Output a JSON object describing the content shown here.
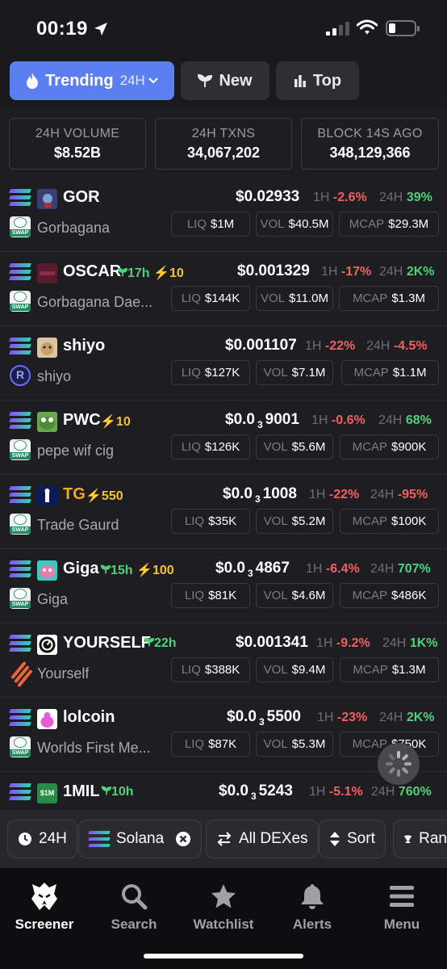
{
  "status": {
    "time": "00:19"
  },
  "tabs": [
    {
      "label": "Trending",
      "sub": "24H",
      "active": true
    },
    {
      "label": "New",
      "active": false
    },
    {
      "label": "Top",
      "active": false
    }
  ],
  "stats": [
    {
      "label": "24H VOLUME",
      "value": "$8.52B"
    },
    {
      "label": "24H TXNS",
      "value": "34,067,202"
    },
    {
      "label": "BLOCK 14S AGO",
      "value": "348,129,366"
    }
  ],
  "labels": {
    "h1": "1H",
    "h24": "24H",
    "liq": "LIQ",
    "vol": "VOL",
    "mcap": "MCAP"
  },
  "tokens": [
    {
      "symbol": "GOR",
      "name": "Gorbagana",
      "price": "$0.02933",
      "h1": "-2.6%",
      "h24": "39%",
      "liq": "$1M",
      "vol": "$40.5M",
      "mcap": "$29.3M"
    },
    {
      "symbol": "OSCAR",
      "age": "17h",
      "boost": "10",
      "name": "Gorbagana Dae...",
      "price": "$0.001329",
      "h1": "-17%",
      "h24": "2K%",
      "liq": "$144K",
      "vol": "$11.0M",
      "mcap": "$1.3M"
    },
    {
      "symbol": "shiyo",
      "name": "shiyo",
      "price": "$0.001107",
      "h1": "-22%",
      "h24": "-4.5%",
      "liq": "$127K",
      "vol": "$7.1M",
      "mcap": "$1.1M"
    },
    {
      "symbol": "PWC",
      "boost": "10",
      "name": "pepe wif cig",
      "price_pre": "$0.0",
      "price_sub": "3",
      "price_post": "9001",
      "h1": "-0.6%",
      "h24": "68%",
      "liq": "$126K",
      "vol": "$5.6M",
      "mcap": "$900K"
    },
    {
      "symbol": "TG",
      "boost": "550",
      "name": "Trade Gaurd",
      "price_pre": "$0.0",
      "price_sub": "3",
      "price_post": "1008",
      "h1": "-22%",
      "h24": "-95%",
      "liq": "$35K",
      "vol": "$5.2M",
      "mcap": "$100K"
    },
    {
      "symbol": "Giga",
      "age": "15h",
      "boost": "100",
      "name": "Giga",
      "price_pre": "$0.0",
      "price_sub": "3",
      "price_post": "4867",
      "h1": "-6.4%",
      "h24": "707%",
      "liq": "$81K",
      "vol": "$4.6M",
      "mcap": "$486K"
    },
    {
      "symbol": "YOURSELF",
      "age": "22h",
      "name": "Yourself",
      "price": "$0.001341",
      "h1": "-9.2%",
      "h24": "1K%",
      "liq": "$388K",
      "vol": "$9.4M",
      "mcap": "$1.3M"
    },
    {
      "symbol": "lolcoin",
      "name": "Worlds First Me...",
      "price_pre": "$0.0",
      "price_sub": "3",
      "price_post": "5500",
      "h1": "-23%",
      "h24": "2K%",
      "liq": "$87K",
      "vol": "$5.3M",
      "mcap": "$750K"
    },
    {
      "symbol": "1MIL",
      "age": "10h",
      "price_pre": "$0.0",
      "price_sub": "3",
      "price_post": "5243",
      "h1": "-5.1%",
      "h24": "760%",
      "avatar_text": "$1M"
    }
  ],
  "filters": [
    {
      "label": "24H"
    },
    {
      "label": "Solana"
    },
    {
      "label": "All DEXes"
    },
    {
      "label": "Sort"
    },
    {
      "label": "Ran"
    }
  ],
  "nav": [
    {
      "label": "Screener",
      "icon": "screener-icon"
    },
    {
      "label": "Search",
      "icon": "search-icon"
    },
    {
      "label": "Watchlist",
      "icon": "star-icon"
    },
    {
      "label": "Alerts",
      "icon": "bell-icon"
    },
    {
      "label": "Menu",
      "icon": "menu-icon"
    }
  ],
  "colors": {
    "accent": "#5b7ff0",
    "positive": "#4ed27a",
    "negative": "#f0605e",
    "boost": "#f4c430"
  }
}
